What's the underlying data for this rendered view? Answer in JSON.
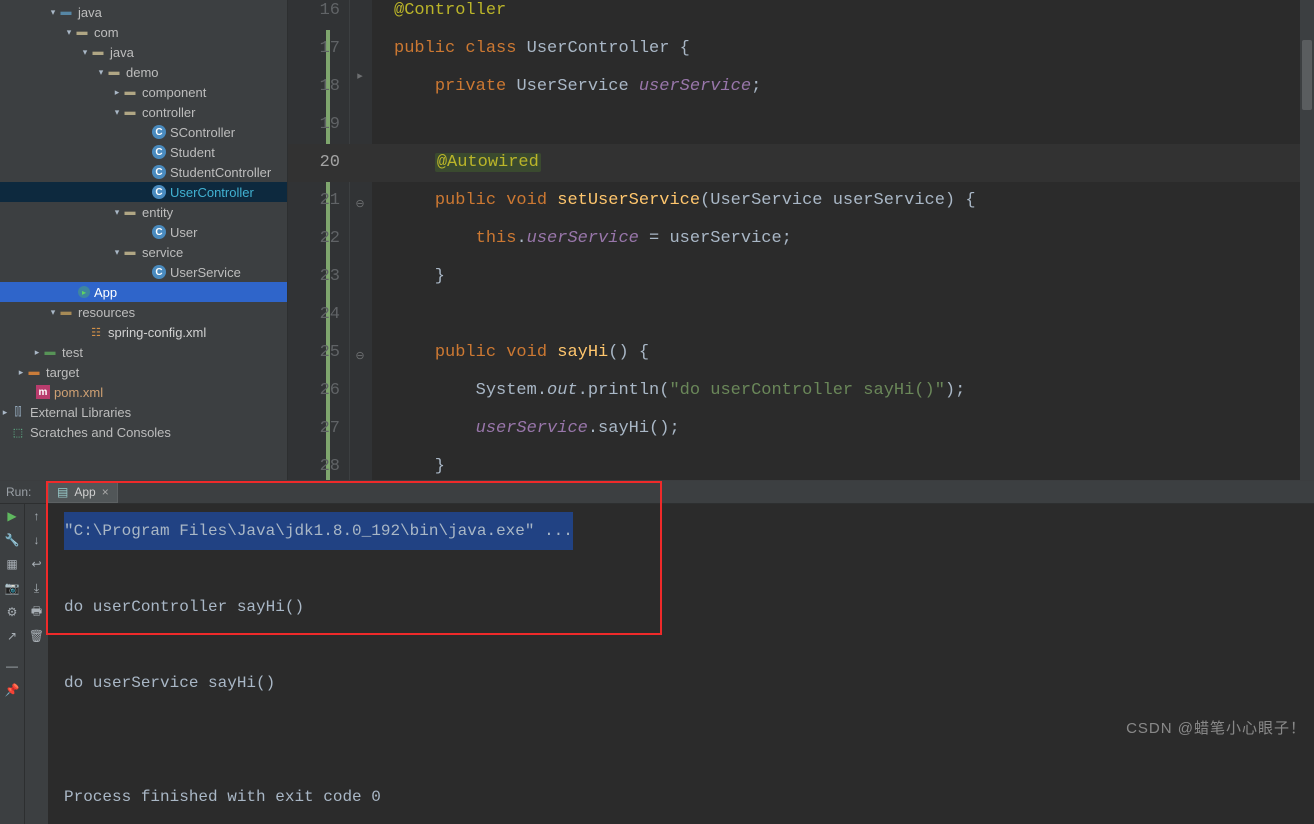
{
  "tree": {
    "java1": "java",
    "com": "com",
    "java2": "java",
    "demo": "demo",
    "component": "component",
    "controller": "controller",
    "SController": "SController",
    "Student": "Student",
    "StudentController": "StudentController",
    "UserController": "UserController",
    "entity": "entity",
    "User": "User",
    "service": "service",
    "UserService": "UserService",
    "App": "App",
    "resources": "resources",
    "spring_config": "spring-config.xml",
    "test": "test",
    "target": "target",
    "pom": "pom.xml",
    "ext_lib": "External Libraries",
    "scratch": "Scratches and Consoles"
  },
  "editor": {
    "lines": [
      {
        "n": 16,
        "tokens": [
          [
            "@Controller",
            "anno"
          ]
        ]
      },
      {
        "n": 17,
        "tokens": [
          [
            "public ",
            "kw"
          ],
          [
            "class ",
            "kw"
          ],
          [
            "UserController ",
            "ident"
          ],
          [
            "{",
            "ident"
          ]
        ]
      },
      {
        "n": 18,
        "tokens": [
          [
            "    ",
            ""
          ],
          [
            "private ",
            "kw"
          ],
          [
            "UserService ",
            "type"
          ],
          [
            "userService",
            "field"
          ],
          [
            ";",
            "ident"
          ]
        ]
      },
      {
        "n": 19,
        "tokens": []
      },
      {
        "n": 20,
        "tokens": [
          [
            "    ",
            ""
          ],
          [
            "@Autowired",
            "anno hl"
          ]
        ],
        "current": true
      },
      {
        "n": 21,
        "tokens": [
          [
            "    ",
            ""
          ],
          [
            "public ",
            "kw"
          ],
          [
            "void ",
            "kw"
          ],
          [
            "setUserService",
            "method"
          ],
          [
            "(UserService userService) {",
            "ident"
          ]
        ]
      },
      {
        "n": 22,
        "tokens": [
          [
            "        ",
            ""
          ],
          [
            "this",
            "kw"
          ],
          [
            ".",
            "ident"
          ],
          [
            "userService",
            "field"
          ],
          [
            " = userService;",
            "ident"
          ]
        ]
      },
      {
        "n": 23,
        "tokens": [
          [
            "    }",
            "ident"
          ]
        ]
      },
      {
        "n": 24,
        "tokens": []
      },
      {
        "n": 25,
        "tokens": [
          [
            "    ",
            ""
          ],
          [
            "public ",
            "kw"
          ],
          [
            "void ",
            "kw"
          ],
          [
            "sayHi",
            "method"
          ],
          [
            "() {",
            "ident"
          ]
        ]
      },
      {
        "n": 26,
        "tokens": [
          [
            "        System.",
            "ident"
          ],
          [
            "out",
            "static field"
          ],
          [
            ".println(",
            "ident"
          ],
          [
            "\"do userController sayHi()\"",
            "str"
          ],
          [
            ");",
            "ident"
          ]
        ]
      },
      {
        "n": 27,
        "tokens": [
          [
            "        ",
            ""
          ],
          [
            "userService",
            "field"
          ],
          [
            ".sayHi();",
            "ident"
          ]
        ]
      },
      {
        "n": 28,
        "tokens": [
          [
            "    }",
            "ident"
          ]
        ]
      }
    ]
  },
  "run": {
    "label": "Run:",
    "tab": "App",
    "cmd": "\"C:\\Program Files\\Java\\jdk1.8.0_192\\bin\\java.exe\" ...",
    "out1": "do userController sayHi()",
    "out2": "do userService sayHi()",
    "exit": "Process finished with exit code 0"
  },
  "watermark": "CSDN @蜡笔小心眼子！"
}
